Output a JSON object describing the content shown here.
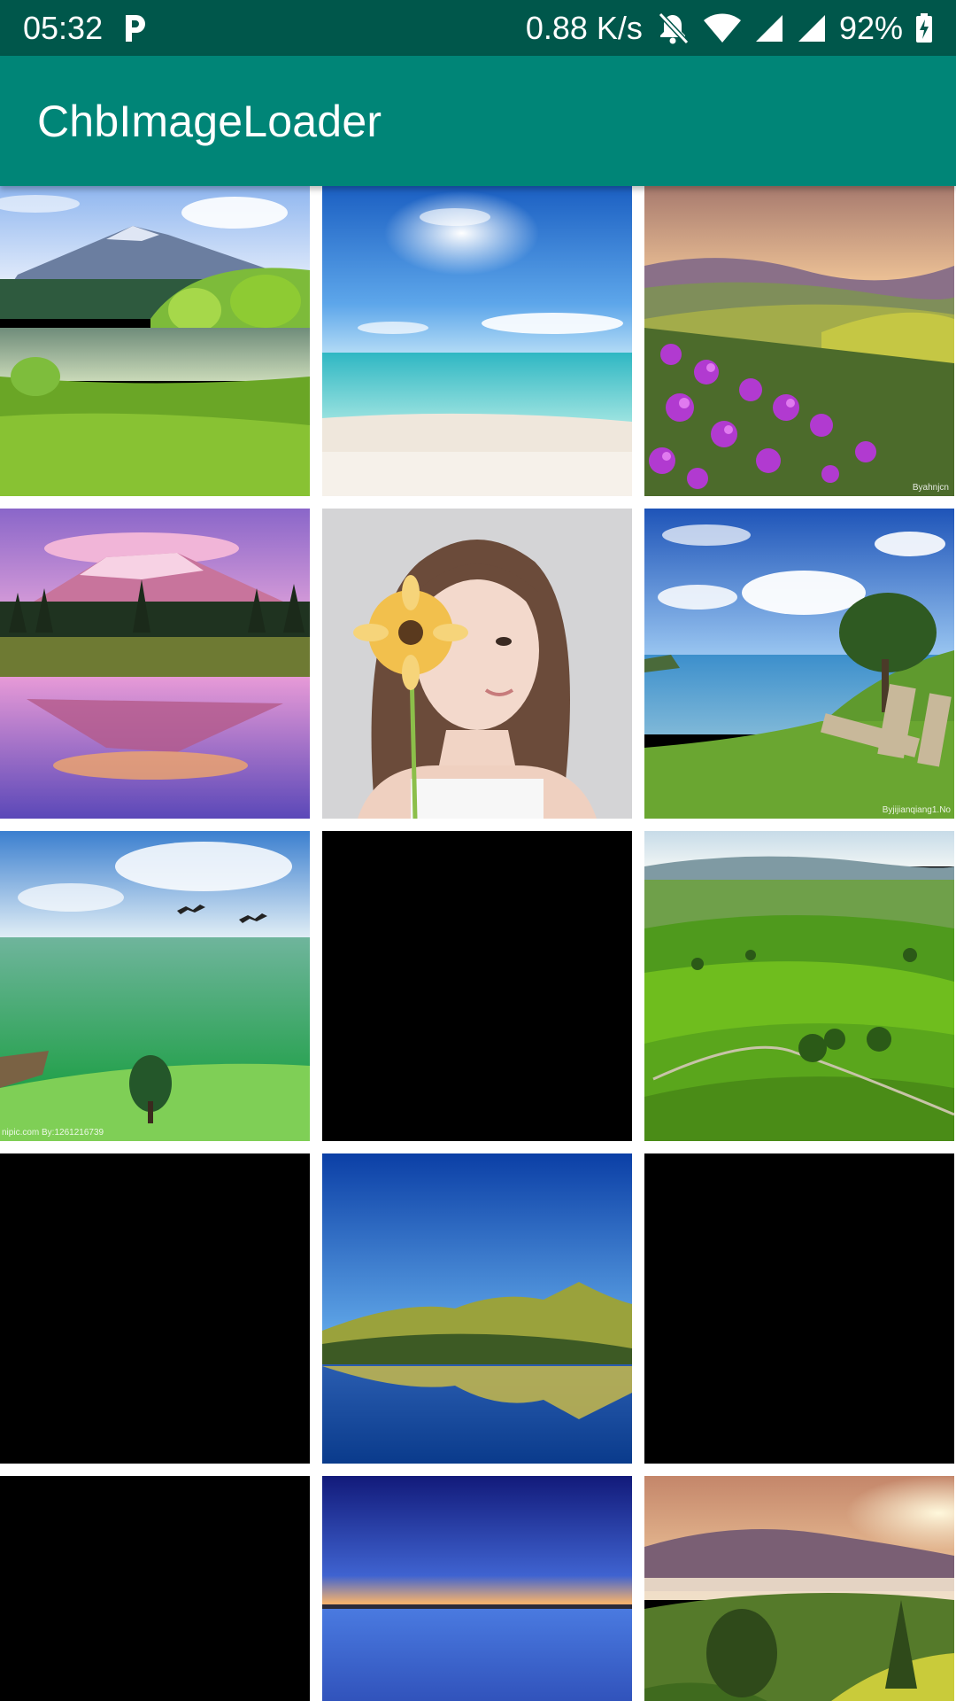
{
  "status_bar": {
    "time": "05:32",
    "network_speed": "0.88 K/s",
    "battery": "92%",
    "background": "#00574b"
  },
  "app_bar": {
    "title": "ChbImageLoader",
    "background": "#008577"
  },
  "grid": {
    "columns": 3,
    "items": [
      {
        "content": "mountain-lake-photo"
      },
      {
        "content": "tropical-beach-photo"
      },
      {
        "content": "purple-flower-hillside-photo",
        "watermark": "Byahnjcn"
      },
      {
        "content": "pink-mountain-reflection-photo"
      },
      {
        "content": "girl-with-sunflower-photo"
      },
      {
        "content": "coast-bench-photo",
        "watermark": "Byjijianqiang1.No"
      },
      {
        "content": "green-sea-birds-photo",
        "watermark": "nipic.com   By:1261216739"
      },
      {
        "content": "empty-black-placeholder"
      },
      {
        "content": "green-rolling-hills-photo"
      },
      {
        "content": "empty-black-placeholder"
      },
      {
        "content": "lake-mountain-reflection-photo"
      },
      {
        "content": "empty-black-placeholder"
      },
      {
        "content": "empty-black-placeholder"
      },
      {
        "content": "blue-dusk-lake-photo"
      },
      {
        "content": "sunset-valley-photo"
      }
    ]
  }
}
